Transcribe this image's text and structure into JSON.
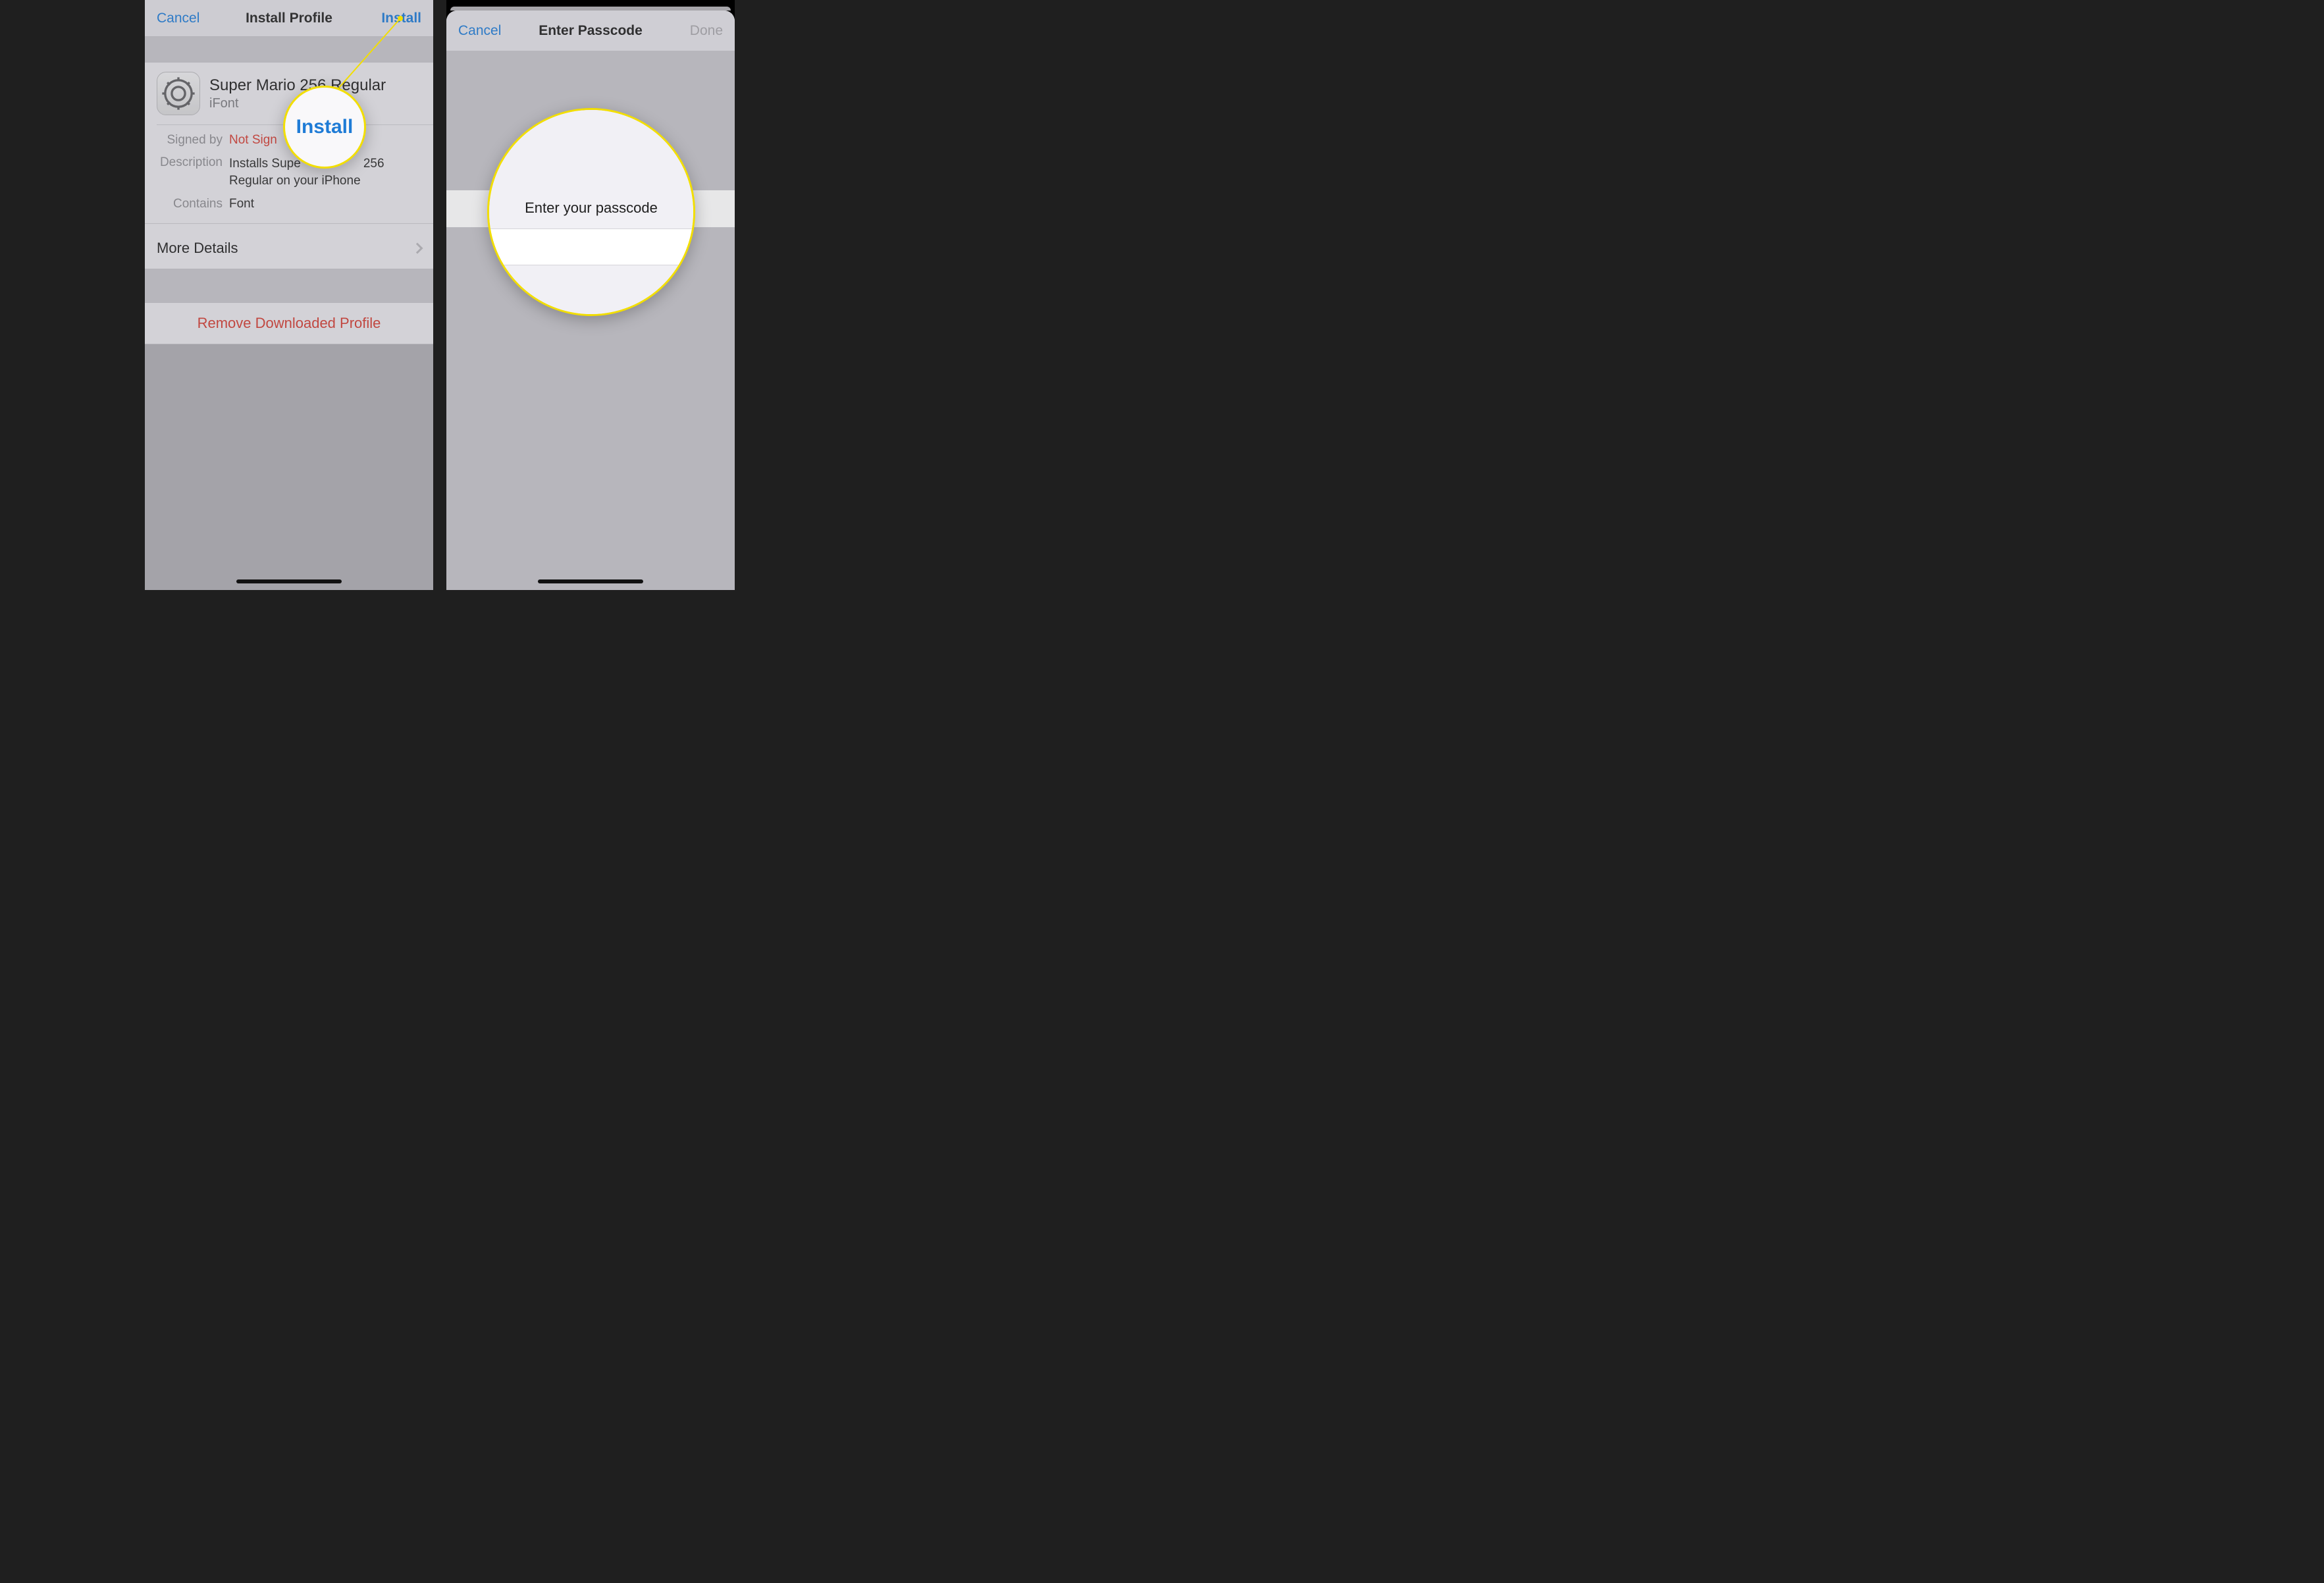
{
  "left": {
    "nav": {
      "cancel": "Cancel",
      "title": "Install Profile",
      "install": "Install"
    },
    "profile": {
      "title": "Super Mario 256 Regular",
      "subtitle": "iFont"
    },
    "fields": {
      "signed_by_label": "Signed by",
      "signed_by_value": "Not Signed",
      "signed_by_value_visible": "Not Sign",
      "description_label": "Description",
      "description_value": "Installs Super Mario 256 Regular on your iPhone",
      "description_value_part1": "Installs Supe",
      "description_value_part2": "256 Regular on your iPhone",
      "contains_label": "Contains",
      "contains_value": "Font"
    },
    "more_details": "More Details",
    "remove": "Remove Downloaded Profile",
    "callout_label": "Install"
  },
  "right": {
    "nav": {
      "cancel": "Cancel",
      "title": "Enter Passcode",
      "done": "Done"
    },
    "prompt": "Enter your passcode"
  },
  "colors": {
    "accent": "#1e7bd6",
    "danger": "#d13c33",
    "highlight_ring": "#f2de00"
  }
}
